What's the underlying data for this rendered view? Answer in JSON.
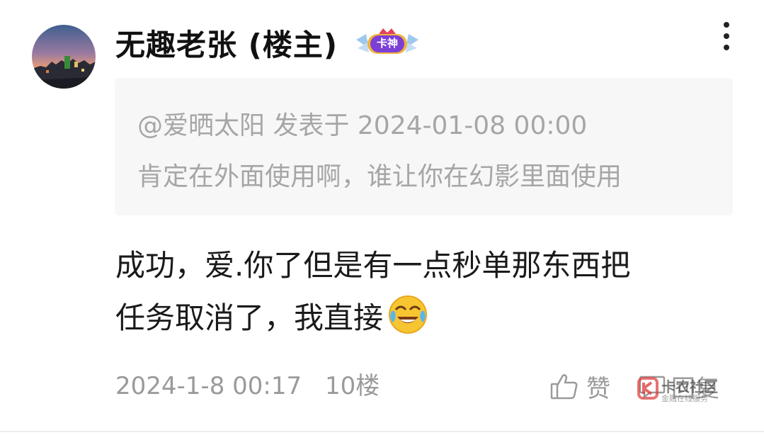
{
  "post": {
    "username": "无趣老张 (楼主)",
    "badge_label": "卡神",
    "quote": {
      "header": "@爱晒太阳 发表于 2024-01-08 00:00",
      "text": "肯定在外面使用啊，谁让你在幻影里面使用"
    },
    "content": {
      "line1": "成功，爱.你了但是有一点秒单那东西把",
      "line2": "任务取消了，我直接",
      "emoji": "crying-laughing-emoji"
    },
    "meta": {
      "datetime": "2024-1-8 00:17",
      "floor": "10楼"
    },
    "actions": {
      "like_label": "赞",
      "reply_label": "回复"
    },
    "watermark": {
      "title": "卡农社区",
      "subtitle": "金融在线服务"
    },
    "icons": {
      "more": "more-vertical-icon",
      "like": "thumbs-up-icon",
      "reply": "reply-icon"
    },
    "colors": {
      "text_primary": "#111111",
      "text_secondary": "#9a9a9a",
      "quote_bg": "#f7f7f7",
      "badge_purple": "#7b3fd6",
      "badge_gold": "#f2b33d"
    }
  }
}
